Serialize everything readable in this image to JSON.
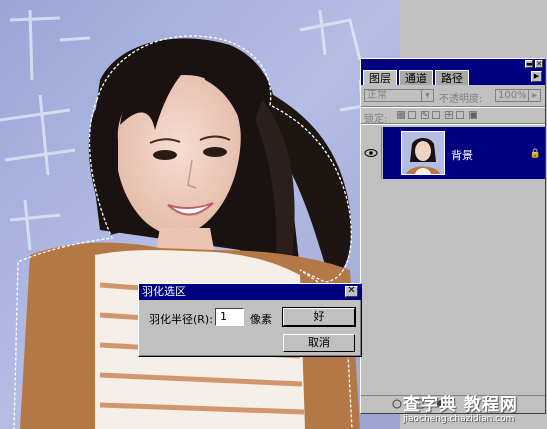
{
  "layers_panel": {
    "tabs": [
      {
        "label": "图层",
        "active": true
      },
      {
        "label": "通道",
        "active": false
      },
      {
        "label": "路径",
        "active": false
      }
    ],
    "blend_mode": "正常",
    "opacity_label": "不透明度:",
    "opacity_value": "100%",
    "lock_label": "锁定:",
    "layers": [
      {
        "name": "背景",
        "visible": true,
        "locked": true
      }
    ]
  },
  "feather_dialog": {
    "title": "羽化选区",
    "radius_label": "羽化半径(R):",
    "radius_value": "1",
    "radius_unit": "像素",
    "ok_label": "好",
    "cancel_label": "取消",
    "close_glyph": "✕"
  },
  "watermark": {
    "title": "查字典 教程网",
    "url": "jiaocheng.chazidian.com"
  },
  "colors": {
    "titlebar": "#000080",
    "chrome": "#c0c0c0",
    "canvas_bg": "#a8b3da"
  }
}
